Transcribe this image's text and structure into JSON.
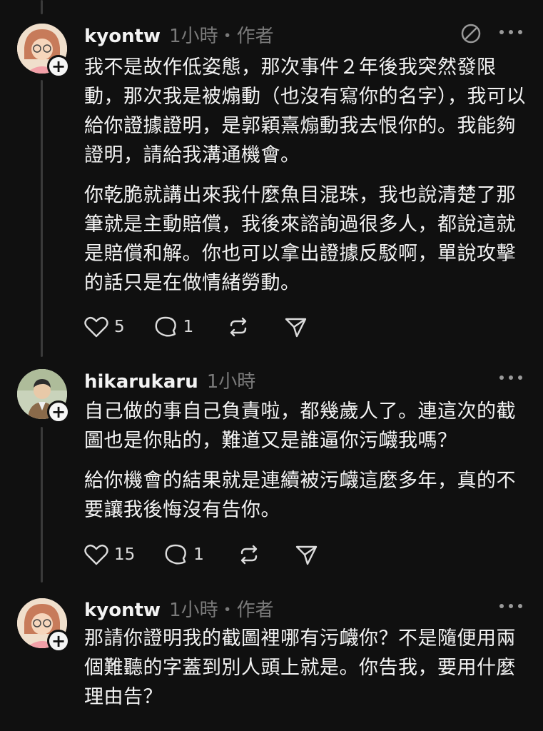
{
  "posts": [
    {
      "username": "kyontw",
      "meta": "1小時・作者",
      "paragraphs": [
        "我不是故作低姿態，那次事件２年後我突然發限動，那次我是被煽動（也沒有寫你的名字），我可以給你證據證明，是郭穎熹煽動我去恨你的。我能夠證明，請給我溝通機會。",
        "你乾脆就講出來我什麼魚目混珠，我也說清楚了那筆就是主動賠償，我後來諮詢過很多人，都說這就是賠償和解。你也可以拿出證據反駁啊，單說攻擊的話只是在做情緒勞動。"
      ],
      "likes": "5",
      "replies": "1"
    },
    {
      "username": "hikarukaru",
      "meta": "1小時",
      "paragraphs": [
        "自己做的事自己負責啦，都幾歲人了。連這次的截圖也是你貼的，難道又是誰逼你污衊我嗎？",
        "給你機會的結果就是連續被污衊這麼多年，真的不要讓我後悔沒有告你。"
      ],
      "likes": "15",
      "replies": "1"
    },
    {
      "username": "kyontw",
      "meta": "1小時・作者",
      "paragraphs": [
        "那請你證明我的截圖裡哪有污衊你？不是隨便用兩個難聽的字蓋到別人頭上就是。你告我，要用什麼理由告？"
      ]
    }
  ],
  "icons": {
    "like": "heart-icon",
    "reply": "comment-icon",
    "repost": "repost-icon",
    "share": "send-icon",
    "more": "more-icon",
    "edit": "edit-icon",
    "follow": "plus-icon"
  },
  "colors": {
    "background": "#101010",
    "text": "#f3f3f3",
    "muted": "#7a7a7a",
    "thread_line": "#3a3a3a"
  }
}
